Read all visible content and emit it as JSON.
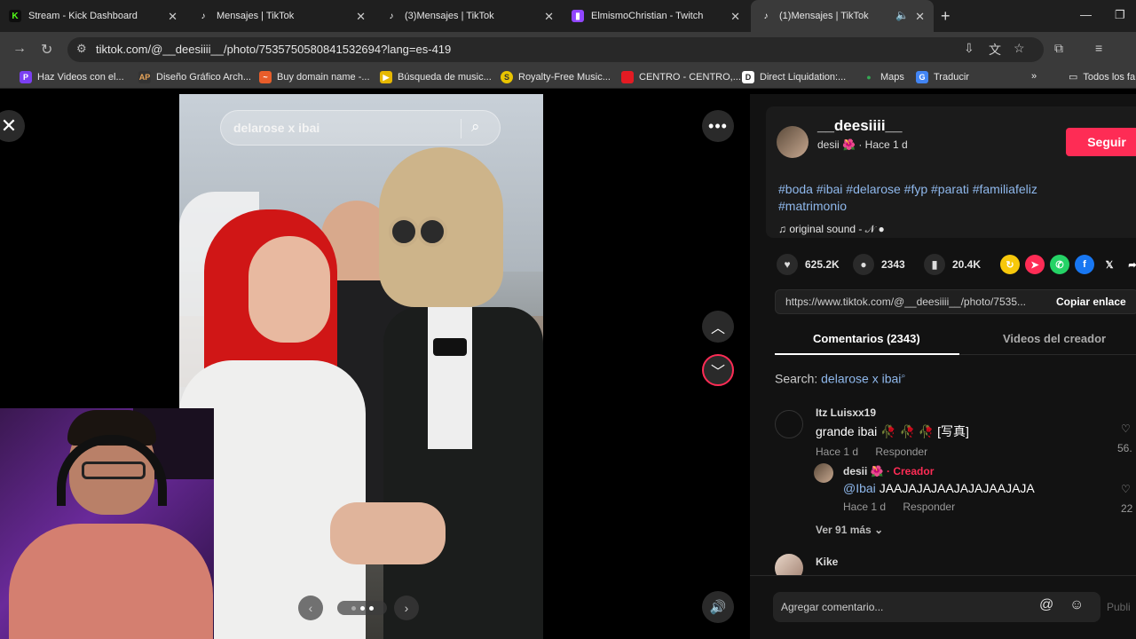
{
  "tabs": [
    {
      "title": "Stream - Kick Dashboard",
      "icon": "kick-icon",
      "color": "#53fc18"
    },
    {
      "title": "Mensajes | TikTok",
      "icon": "tiktok-icon"
    },
    {
      "title": "(3)Mensajes | TikTok",
      "icon": "tiktok-icon"
    },
    {
      "title": "ElmismoChristian - Twitch",
      "icon": "twitch-icon",
      "color": "#9146ff"
    },
    {
      "title": "(1)Mensajes | TikTok",
      "icon": "tiktok-icon",
      "active": true
    }
  ],
  "address": {
    "url": "tiktok.com/@__deesiiii__/photo/7535750580841532694?lang=es-419"
  },
  "bookmarks": [
    {
      "label": "Haz Videos con el...",
      "icon_text": "P",
      "color": "#7b3ff2"
    },
    {
      "label": "Diseño Gráfico Arch...",
      "icon_text": "AP",
      "color": "#333333"
    },
    {
      "label": "Buy domain name -...",
      "icon_text": "~",
      "color": "#e85d2a"
    },
    {
      "label": "Búsqueda de music...",
      "icon_text": "▶",
      "color": "#e6b800"
    },
    {
      "label": "Royalty-Free Music...",
      "icon_text": "S",
      "color": "#e8c400"
    },
    {
      "label": "CENTRO - CENTRO,...",
      "icon_text": "",
      "color": "#e31b23"
    },
    {
      "label": "Direct Liquidation:...",
      "icon_text": "D",
      "color": "#ffffff"
    },
    {
      "label": "Maps",
      "icon_text": "●",
      "color": "#34a853"
    },
    {
      "label": "Traducir",
      "icon_text": "G",
      "color": "#4285f4"
    }
  ],
  "bookmarks_all": "Todos los fa",
  "viewer": {
    "search_query": "delarose x ibai"
  },
  "post": {
    "username": "__deesiiii__",
    "display_name": "desii",
    "rose": "🌺",
    "time": "· Hace 1 d",
    "follow_label": "Seguir",
    "hashtags": "#boda #ibai #delarose #fyp #parati #familiafeliz #matrimonio",
    "sound": "original sound - 𝒩 ●",
    "likes": "625.2K",
    "comments": "2343",
    "saves": "20.4K",
    "link": "https://www.tiktok.com/@__deesiiii__/photo/7535...",
    "copy_label": "Copiar enlace"
  },
  "panel_tabs": {
    "comments": "Comentarios (2343)",
    "creator_videos": "Videos del creador"
  },
  "search_line": {
    "prefix": "Search:",
    "query": "delarose x ibai"
  },
  "comments": [
    {
      "name": "Itz Luisxx19",
      "text": "grande ibai 🥀 🥀 🥀 [写真]",
      "time": "Hace 1 d",
      "reply": "Responder",
      "likes": "56."
    },
    {
      "name": "desii",
      "badge": "Creador",
      "mention": "@Ibai",
      "text": "JAAJAJAJAAJAJAJAAJAJA",
      "time": "Hace 1 d",
      "reply": "Responder",
      "likes": "22"
    },
    {
      "name": "Kike"
    }
  ],
  "see_more": "Ver 91 más",
  "comment_input": {
    "placeholder": "Agregar comentario...",
    "post_label": "Publi"
  }
}
